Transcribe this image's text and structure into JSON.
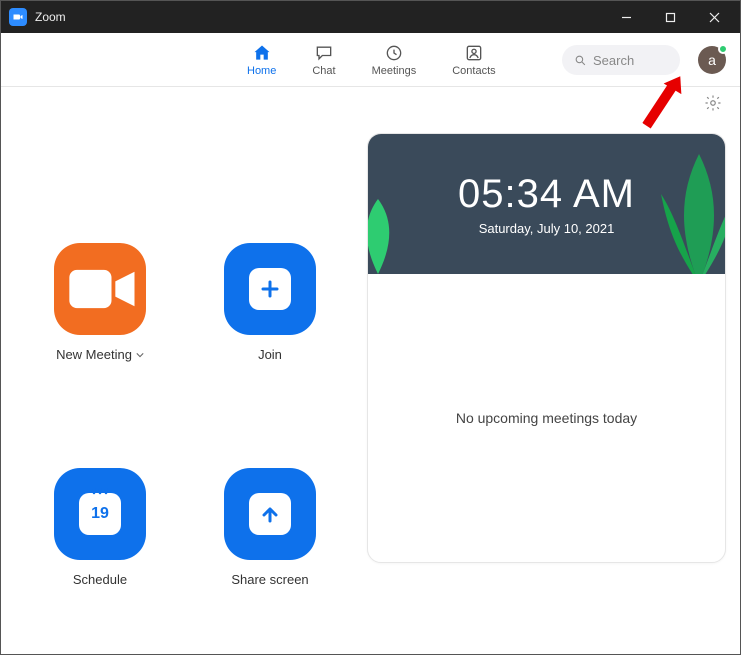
{
  "window": {
    "title": "Zoom"
  },
  "nav": {
    "home": "Home",
    "chat": "Chat",
    "meetings": "Meetings",
    "contacts": "Contacts"
  },
  "search": {
    "placeholder": "Search"
  },
  "avatar": {
    "letter": "a"
  },
  "tiles": {
    "new_meeting": "New Meeting",
    "join": "Join",
    "schedule": "Schedule",
    "share": "Share screen",
    "calendar_day": "19"
  },
  "clock": {
    "time": "05:34 AM",
    "date": "Saturday, July 10, 2021"
  },
  "meetings_empty": "No upcoming meetings today"
}
